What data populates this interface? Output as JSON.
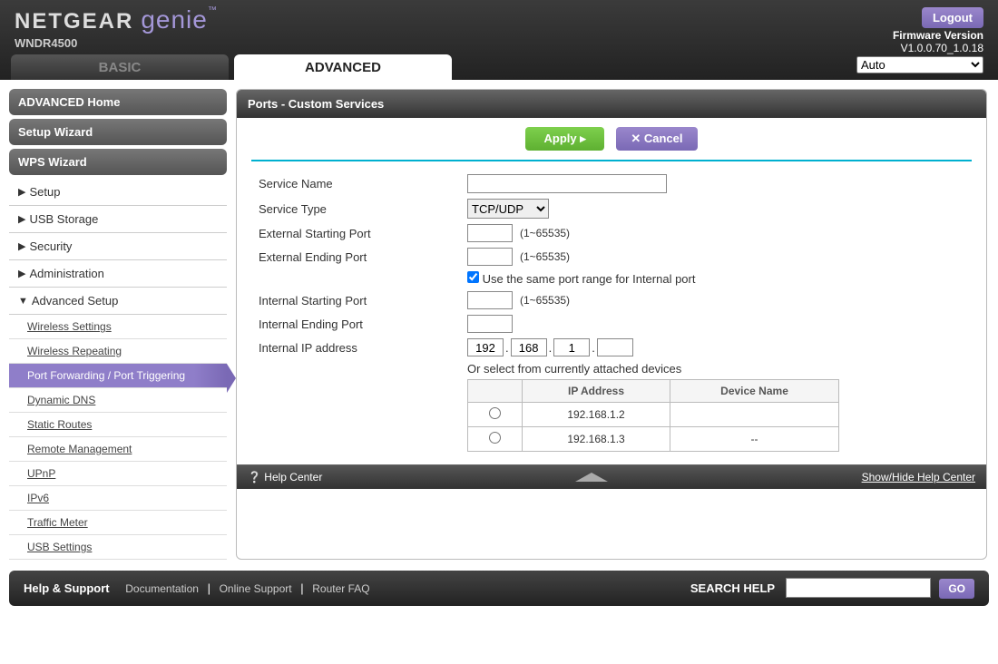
{
  "header": {
    "brand1": "NETGEAR",
    "brand2": "genie",
    "tm": "™",
    "model": "WNDR4500",
    "logout": "Logout",
    "fw_label": "Firmware Version",
    "fw_version": "V1.0.0.70_1.0.18",
    "lang_selected": "Auto"
  },
  "tabs": {
    "basic": "BASIC",
    "advanced": "ADVANCED"
  },
  "sidebar": {
    "advanced_home": "ADVANCED Home",
    "setup_wizard": "Setup Wizard",
    "wps_wizard": "WPS Wizard",
    "items": [
      "Setup",
      "USB Storage",
      "Security",
      "Administration",
      "Advanced Setup"
    ],
    "sub_items": [
      "Wireless Settings",
      "Wireless Repeating",
      "Port Forwarding / Port Triggering",
      "Dynamic DNS",
      "Static Routes",
      "Remote Management",
      "UPnP",
      "IPv6",
      "Traffic Meter",
      "USB Settings"
    ]
  },
  "content": {
    "title": "Ports - Custom Services",
    "apply": "Apply ▸",
    "cancel": "✕ Cancel",
    "form": {
      "service_name_label": "Service Name",
      "service_type_label": "Service Type",
      "service_type_value": "TCP/UDP",
      "ext_start_label": "External Starting Port",
      "ext_end_label": "External Ending Port",
      "range_hint": "(1~65535)",
      "same_port_label": "Use the same port range for Internal port",
      "int_start_label": "Internal Starting Port",
      "int_end_label": "Internal Ending Port",
      "int_ip_label": "Internal IP address",
      "ip": {
        "o1": "192",
        "o2": "168",
        "o3": "1",
        "o4": ""
      },
      "or_select": "Or select from currently attached devices",
      "th_ip": "IP Address",
      "th_name": "Device Name",
      "devices": [
        {
          "ip": "192.168.1.2",
          "name": ""
        },
        {
          "ip": "192.168.1.3",
          "name": "--"
        }
      ]
    },
    "help_center": "Help Center",
    "show_hide": "Show/Hide Help Center"
  },
  "footer": {
    "hs": "Help & Support",
    "links": [
      "Documentation",
      "Online Support",
      "Router FAQ"
    ],
    "search_label": "SEARCH HELP",
    "go": "GO"
  }
}
